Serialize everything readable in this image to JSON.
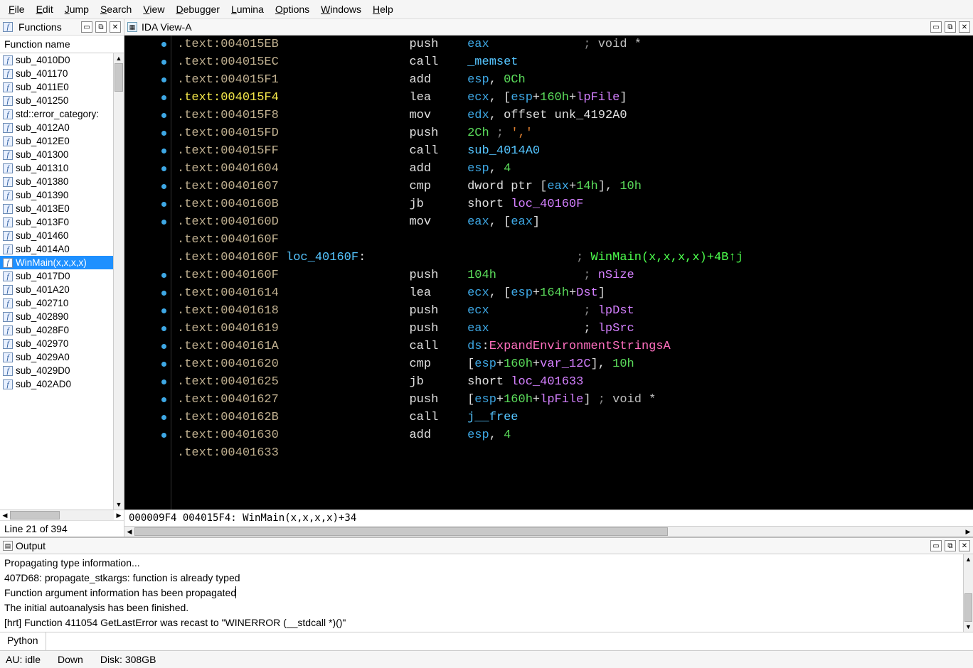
{
  "menu": [
    "File",
    "Edit",
    "Jump",
    "Search",
    "View",
    "Debugger",
    "Lumina",
    "Options",
    "Windows",
    "Help"
  ],
  "functions_panel": {
    "title": "Functions",
    "column": "Function name",
    "items": [
      "sub_4010D0",
      "sub_401170",
      "sub_4011E0",
      "sub_401250",
      "std::error_category:",
      "sub_4012A0",
      "sub_4012E0",
      "sub_401300",
      "sub_401310",
      "sub_401380",
      "sub_401390",
      "sub_4013E0",
      "sub_4013F0",
      "sub_401460",
      "sub_4014A0",
      "WinMain(x,x,x,x)",
      "sub_4017D0",
      "sub_401A20",
      "sub_402710",
      "sub_402890",
      "sub_4028F0",
      "sub_402970",
      "sub_4029A0",
      "sub_4029D0",
      "sub_402AD0"
    ],
    "selected_index": 15,
    "line_status": "Line 21 of 394"
  },
  "ida_view": {
    "tab_title": "IDA View-A",
    "status": "000009F4 004015F4: WinMain(x,x,x,x)+34",
    "lines": [
      {
        "addr": ".text:004015EB",
        "addr_cls": "",
        "dot": true,
        "body": [
          {
            "t": "                  ",
            "c": ""
          },
          {
            "t": "push",
            "c": "mnem"
          },
          {
            "t": "    ",
            "c": ""
          },
          {
            "t": "eax",
            "c": "reg"
          },
          {
            "t": "             ",
            "c": ""
          },
          {
            "t": "; ",
            "c": "cmt"
          },
          {
            "t": "void *",
            "c": "cmtbright"
          }
        ]
      },
      {
        "addr": ".text:004015EC",
        "addr_cls": "",
        "dot": true,
        "body": [
          {
            "t": "                  ",
            "c": ""
          },
          {
            "t": "call",
            "c": "mnem"
          },
          {
            "t": "    ",
            "c": ""
          },
          {
            "t": "_memset",
            "c": "lbl"
          }
        ]
      },
      {
        "addr": ".text:004015F1",
        "addr_cls": "",
        "dot": true,
        "body": [
          {
            "t": "                  ",
            "c": ""
          },
          {
            "t": "add",
            "c": "mnem"
          },
          {
            "t": "     ",
            "c": ""
          },
          {
            "t": "esp",
            "c": "reg"
          },
          {
            "t": ", ",
            "c": ""
          },
          {
            "t": "0Ch",
            "c": "num"
          }
        ]
      },
      {
        "addr": ".text:004015F4",
        "addr_cls": "yellow",
        "dot": true,
        "body": [
          {
            "t": "                  ",
            "c": ""
          },
          {
            "t": "lea",
            "c": "mnem"
          },
          {
            "t": "     ",
            "c": ""
          },
          {
            "t": "ecx",
            "c": "reg"
          },
          {
            "t": ", [",
            "c": ""
          },
          {
            "t": "esp",
            "c": "reg"
          },
          {
            "t": "+",
            "c": ""
          },
          {
            "t": "160h",
            "c": "num"
          },
          {
            "t": "+",
            "c": ""
          },
          {
            "t": "lpFile",
            "c": "sym"
          },
          {
            "t": "]",
            "c": ""
          }
        ]
      },
      {
        "addr": ".text:004015F8",
        "addr_cls": "",
        "dot": true,
        "body": [
          {
            "t": "                  ",
            "c": ""
          },
          {
            "t": "mov",
            "c": "mnem"
          },
          {
            "t": "     ",
            "c": ""
          },
          {
            "t": "edx",
            "c": "reg"
          },
          {
            "t": ", ",
            "c": ""
          },
          {
            "t": "offset",
            "c": "mnem"
          },
          {
            "t": " ",
            "c": ""
          },
          {
            "t": "unk_4192A0",
            "c": "mnem"
          }
        ]
      },
      {
        "addr": ".text:004015FD",
        "addr_cls": "",
        "dot": true,
        "body": [
          {
            "t": "                  ",
            "c": ""
          },
          {
            "t": "push",
            "c": "mnem"
          },
          {
            "t": "    ",
            "c": ""
          },
          {
            "t": "2Ch",
            "c": "num"
          },
          {
            "t": " ",
            "c": ""
          },
          {
            "t": "; ",
            "c": "cmt"
          },
          {
            "t": "','",
            "c": "str"
          }
        ]
      },
      {
        "addr": ".text:004015FF",
        "addr_cls": "",
        "dot": true,
        "body": [
          {
            "t": "                  ",
            "c": ""
          },
          {
            "t": "call",
            "c": "mnem"
          },
          {
            "t": "    ",
            "c": ""
          },
          {
            "t": "sub_4014A0",
            "c": "lbl"
          }
        ]
      },
      {
        "addr": ".text:00401604",
        "addr_cls": "",
        "dot": true,
        "body": [
          {
            "t": "                  ",
            "c": ""
          },
          {
            "t": "add",
            "c": "mnem"
          },
          {
            "t": "     ",
            "c": ""
          },
          {
            "t": "esp",
            "c": "reg"
          },
          {
            "t": ", ",
            "c": ""
          },
          {
            "t": "4",
            "c": "num"
          }
        ]
      },
      {
        "addr": ".text:00401607",
        "addr_cls": "",
        "dot": true,
        "body": [
          {
            "t": "                  ",
            "c": ""
          },
          {
            "t": "cmp",
            "c": "mnem"
          },
          {
            "t": "     ",
            "c": ""
          },
          {
            "t": "dword ptr",
            "c": "mnem"
          },
          {
            "t": " [",
            "c": ""
          },
          {
            "t": "eax",
            "c": "reg"
          },
          {
            "t": "+",
            "c": ""
          },
          {
            "t": "14h",
            "c": "num"
          },
          {
            "t": "], ",
            "c": ""
          },
          {
            "t": "10h",
            "c": "num"
          }
        ]
      },
      {
        "addr": ".text:0040160B",
        "addr_cls": "",
        "dot": true,
        "body": [
          {
            "t": "                  ",
            "c": ""
          },
          {
            "t": "jb",
            "c": "mnem"
          },
          {
            "t": "      ",
            "c": ""
          },
          {
            "t": "short ",
            "c": "mnem"
          },
          {
            "t": "loc_40160F",
            "c": "sym"
          }
        ]
      },
      {
        "addr": ".text:0040160D",
        "addr_cls": "",
        "dot": true,
        "body": [
          {
            "t": "                  ",
            "c": ""
          },
          {
            "t": "mov",
            "c": "mnem"
          },
          {
            "t": "     ",
            "c": ""
          },
          {
            "t": "eax",
            "c": "reg"
          },
          {
            "t": ", [",
            "c": ""
          },
          {
            "t": "eax",
            "c": "reg"
          },
          {
            "t": "]",
            "c": ""
          }
        ]
      },
      {
        "addr": ".text:0040160F",
        "addr_cls": "",
        "dot": false,
        "body": []
      },
      {
        "addr": ".text:0040160F",
        "addr_cls": "",
        "dot": false,
        "body": [
          {
            "t": " ",
            "c": ""
          },
          {
            "t": "loc_40160F",
            "c": "lbl"
          },
          {
            "t": ":",
            "c": ""
          },
          {
            "t": "                             ",
            "c": ""
          },
          {
            "t": "; ",
            "c": "cmt"
          },
          {
            "t": "WinMain(x,x,x,x)+4B↑j",
            "c": "xref"
          }
        ]
      },
      {
        "addr": ".text:0040160F",
        "addr_cls": "",
        "dot": true,
        "body": [
          {
            "t": "                  ",
            "c": ""
          },
          {
            "t": "push",
            "c": "mnem"
          },
          {
            "t": "    ",
            "c": ""
          },
          {
            "t": "104h",
            "c": "num"
          },
          {
            "t": "            ",
            "c": ""
          },
          {
            "t": "; ",
            "c": "cmt"
          },
          {
            "t": "nSize",
            "c": "sym"
          }
        ]
      },
      {
        "addr": ".text:00401614",
        "addr_cls": "",
        "dot": true,
        "body": [
          {
            "t": "                  ",
            "c": ""
          },
          {
            "t": "lea",
            "c": "mnem"
          },
          {
            "t": "     ",
            "c": ""
          },
          {
            "t": "ecx",
            "c": "reg"
          },
          {
            "t": ", [",
            "c": ""
          },
          {
            "t": "esp",
            "c": "reg"
          },
          {
            "t": "+",
            "c": ""
          },
          {
            "t": "164h",
            "c": "num"
          },
          {
            "t": "+",
            "c": ""
          },
          {
            "t": "Dst",
            "c": "sym"
          },
          {
            "t": "]",
            "c": ""
          }
        ]
      },
      {
        "addr": ".text:00401618",
        "addr_cls": "",
        "dot": true,
        "body": [
          {
            "t": "                  ",
            "c": ""
          },
          {
            "t": "push",
            "c": "mnem"
          },
          {
            "t": "    ",
            "c": ""
          },
          {
            "t": "ecx",
            "c": "reg"
          },
          {
            "t": "             ",
            "c": ""
          },
          {
            "t": "; ",
            "c": "cmt"
          },
          {
            "t": "lpDst",
            "c": "sym"
          }
        ]
      },
      {
        "addr": ".text:00401619",
        "addr_cls": "",
        "dot": true,
        "body": [
          {
            "t": "                  ",
            "c": ""
          },
          {
            "t": "push",
            "c": "mnem"
          },
          {
            "t": "    ",
            "c": ""
          },
          {
            "t": "eax",
            "c": "reg"
          },
          {
            "t": "             ",
            "c": ""
          },
          {
            "t": "; ",
            "c": ""
          },
          {
            "t": "lpSrc",
            "c": "sym"
          }
        ]
      },
      {
        "addr": ".text:0040161A",
        "addr_cls": "",
        "dot": true,
        "body": [
          {
            "t": "                  ",
            "c": ""
          },
          {
            "t": "call",
            "c": "mnem"
          },
          {
            "t": "    ",
            "c": ""
          },
          {
            "t": "ds",
            "c": "reg"
          },
          {
            "t": ":",
            "c": ""
          },
          {
            "t": "ExpandEnvironmentStringsA",
            "c": "api"
          }
        ]
      },
      {
        "addr": ".text:00401620",
        "addr_cls": "",
        "dot": true,
        "body": [
          {
            "t": "                  ",
            "c": ""
          },
          {
            "t": "cmp",
            "c": "mnem"
          },
          {
            "t": "     [",
            "c": ""
          },
          {
            "t": "esp",
            "c": "reg"
          },
          {
            "t": "+",
            "c": ""
          },
          {
            "t": "160h",
            "c": "num"
          },
          {
            "t": "+",
            "c": ""
          },
          {
            "t": "var_12C",
            "c": "sym"
          },
          {
            "t": "], ",
            "c": ""
          },
          {
            "t": "10h",
            "c": "num"
          }
        ]
      },
      {
        "addr": ".text:00401625",
        "addr_cls": "",
        "dot": true,
        "body": [
          {
            "t": "                  ",
            "c": ""
          },
          {
            "t": "jb",
            "c": "mnem"
          },
          {
            "t": "      ",
            "c": ""
          },
          {
            "t": "short ",
            "c": "mnem"
          },
          {
            "t": "loc_401633",
            "c": "sym"
          }
        ]
      },
      {
        "addr": ".text:00401627",
        "addr_cls": "",
        "dot": true,
        "body": [
          {
            "t": "                  ",
            "c": ""
          },
          {
            "t": "push",
            "c": "mnem"
          },
          {
            "t": "    [",
            "c": ""
          },
          {
            "t": "esp",
            "c": "reg"
          },
          {
            "t": "+",
            "c": ""
          },
          {
            "t": "160h",
            "c": "num"
          },
          {
            "t": "+",
            "c": ""
          },
          {
            "t": "lpFile",
            "c": "sym"
          },
          {
            "t": "] ",
            "c": ""
          },
          {
            "t": "; ",
            "c": "cmt"
          },
          {
            "t": "void *",
            "c": "cmtbright"
          }
        ]
      },
      {
        "addr": ".text:0040162B",
        "addr_cls": "",
        "dot": true,
        "body": [
          {
            "t": "                  ",
            "c": ""
          },
          {
            "t": "call",
            "c": "mnem"
          },
          {
            "t": "    ",
            "c": ""
          },
          {
            "t": "j__free",
            "c": "lbl"
          }
        ]
      },
      {
        "addr": ".text:00401630",
        "addr_cls": "",
        "dot": true,
        "body": [
          {
            "t": "                  ",
            "c": ""
          },
          {
            "t": "add",
            "c": "mnem"
          },
          {
            "t": "     ",
            "c": ""
          },
          {
            "t": "esp",
            "c": "reg"
          },
          {
            "t": ", ",
            "c": ""
          },
          {
            "t": "4",
            "c": "num"
          }
        ]
      },
      {
        "addr": ".text:00401633",
        "addr_cls": "",
        "dot": false,
        "body": []
      }
    ]
  },
  "output": {
    "title": "Output",
    "lines": [
      "Propagating type information...",
      "407D68: propagate_stkargs: function is already typed",
      "Function argument information has been propagated",
      "The initial autoanalysis has been finished.",
      "[hrt] Function 411054 GetLastError was recast to \"WINERROR (__stdcall *)()\""
    ]
  },
  "python_label": "Python",
  "status_bar": {
    "au": "AU:   idle",
    "down": "Down",
    "disk": "Disk:  308GB"
  }
}
